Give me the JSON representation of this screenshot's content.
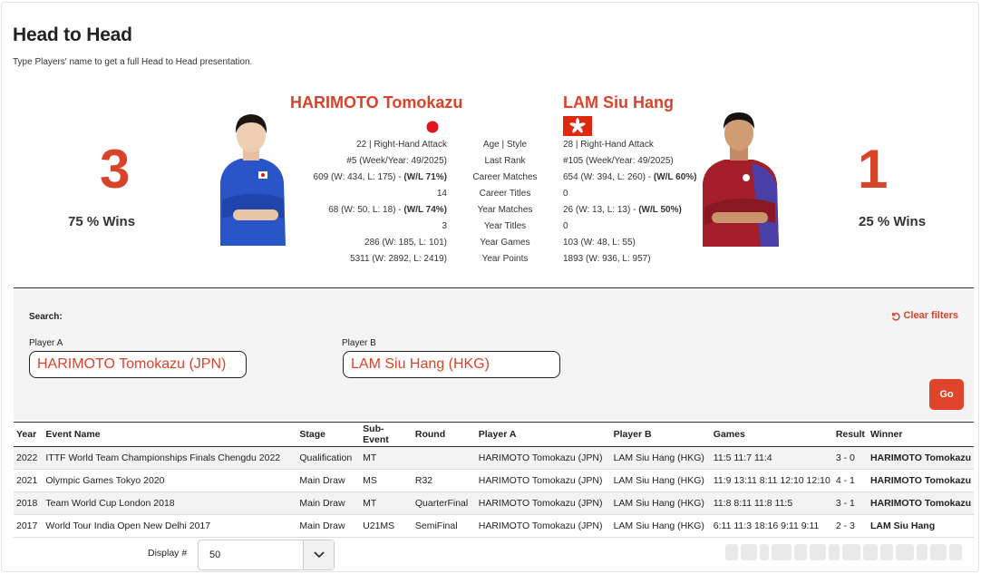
{
  "page": {
    "title": "Head to Head",
    "subtitle": "Type Players' name to get a full Head to Head presentation."
  },
  "player_a": {
    "name": "HARIMOTO Tomokazu",
    "score": "3",
    "wins": "75 % Wins",
    "flag": "japan-flag",
    "stats": [
      "22 | Right-Hand Attack",
      "#5 (Week/Year: 49/2025)",
      "609 (W: 434, L: 175) - ",
      "14",
      "68 (W: 50, L: 18) - ",
      "3",
      "286 (W: 185, L: 101)",
      "5311 (W: 2892, L: 2419)"
    ],
    "career_wl": "(W/L 71%)",
    "year_wl": "(W/L 74%)"
  },
  "player_b": {
    "name": "LAM Siu Hang",
    "score": "1",
    "wins": "25 % Wins",
    "flag": "hong-kong-flag",
    "stats": [
      "28 | Right-Hand Attack",
      "#105 (Week/Year: 49/2025)",
      "654 (W: 394, L: 260) - ",
      "0",
      "26 (W: 13, L: 13) - ",
      "0",
      "103 (W: 48, L: 55)",
      "1893 (W: 936, L: 957)"
    ],
    "career_wl": "(W/L 60%)",
    "year_wl": "(W/L 50%)"
  },
  "stat_labels": [
    "Age | Style",
    "Last Rank",
    "Career Matches",
    "Career Titles",
    "Year Matches",
    "Year Titles",
    "Year Games",
    "Year Points"
  ],
  "search": {
    "label": "Search:",
    "clear_label": "Clear filters",
    "player_a_label": "Player A",
    "player_a_value": "HARIMOTO Tomokazu (JPN)",
    "player_b_label": "Player B",
    "player_b_value": "LAM Siu Hang (HKG)",
    "go_label": "Go"
  },
  "table": {
    "headers": [
      "Year",
      "Event Name",
      "Stage",
      "Sub-Event",
      "Round",
      "Player A",
      "Player B",
      "Games",
      "Result",
      "Winner"
    ],
    "rows": [
      [
        "2022",
        "ITTF World Team Championships Finals Chengdu 2022",
        "Qualification",
        "MT",
        "",
        "HARIMOTO Tomokazu (JPN)",
        "LAM Siu Hang (HKG)",
        "11:5 11:7 11:4",
        "3 - 0",
        "HARIMOTO Tomokazu"
      ],
      [
        "2021",
        "Olympic Games Tokyo 2020",
        "Main Draw",
        "MS",
        "R32",
        "HARIMOTO Tomokazu (JPN)",
        "LAM Siu Hang (HKG)",
        "11:9 13:11 8:11 12:10 12:10",
        "4 - 1",
        "HARIMOTO Tomokazu"
      ],
      [
        "2018",
        "Team World Cup London 2018",
        "Main Draw",
        "MT",
        "QuarterFinal",
        "HARIMOTO Tomokazu (JPN)",
        "LAM Siu Hang (HKG)",
        "11:8 8:11 11:8 11:5",
        "3 - 1",
        "HARIMOTO Tomokazu"
      ],
      [
        "2017",
        "World Tour India Open New Delhi 2017",
        "Main Draw",
        "U21MS",
        "SemiFinal",
        "HARIMOTO Tomokazu (JPN)",
        "LAM Siu Hang (HKG)",
        "6:11 11:3 18:16 9:11 9:11",
        "2 - 3",
        "LAM Siu Hang"
      ]
    ]
  },
  "display": {
    "label": "Display #",
    "value": "50"
  },
  "colors": {
    "accent": "#d9432a",
    "button": "#e0452b"
  }
}
